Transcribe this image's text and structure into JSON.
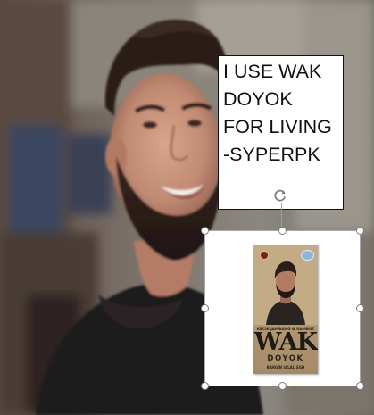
{
  "caption": {
    "lines": [
      "I USE WAK",
      "DOYOK",
      "FOR LIVING",
      "-SYPERPK"
    ]
  },
  "product": {
    "tagline": "KECIK JAMBANG & RAMBUT",
    "brand": "WAK",
    "sub_brand": "DOYOK",
    "footer": "BARGIN JALAL SGD"
  },
  "icons": {
    "rotate": "rotate-handle-icon"
  },
  "colors": {
    "caption_text": "#111111",
    "caption_bg": "#ffffff",
    "selection_border": "#a8a8a8",
    "handle_border": "#7d7d7d"
  }
}
